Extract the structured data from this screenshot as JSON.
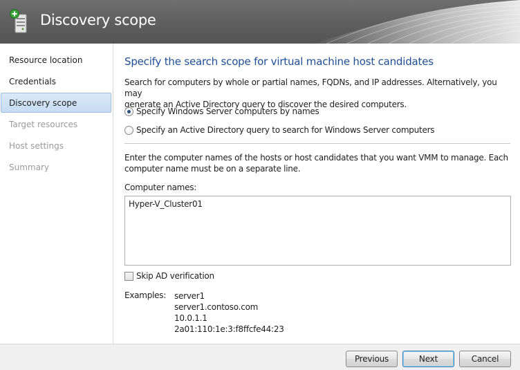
{
  "header": {
    "title": "Discovery scope",
    "icon": "server-add-icon"
  },
  "sidebar": {
    "items": [
      {
        "label": "Resource location",
        "state": "done"
      },
      {
        "label": "Credentials",
        "state": "done"
      },
      {
        "label": "Discovery scope",
        "state": "active"
      },
      {
        "label": "Target resources",
        "state": "pending"
      },
      {
        "label": "Host settings",
        "state": "pending"
      },
      {
        "label": "Summary",
        "state": "pending"
      }
    ]
  },
  "main": {
    "title": "Specify the search scope for virtual machine host candidates",
    "intro_line1": "Search for computers by whole or partial names, FQDNs, and IP addresses. Alternatively, you may",
    "intro_line2": "generate an Active Directory query to discover the desired computers.",
    "option_names": "Specify Windows Server computers by names",
    "option_ad_query": "Specify an Active Directory query to search for Windows Server computers",
    "selected_option": "option_names",
    "instructions_line1": "Enter the computer names of the hosts or host candidates that you want VMM to manage. Each",
    "instructions_line2": "computer name must be on a separate line.",
    "computer_names_label": "Computer names:",
    "computer_names_value": "Hyper-V_Cluster01",
    "skip_ad_label": "Skip AD verification",
    "skip_ad_checked": false,
    "examples_label": "Examples:",
    "examples": [
      "server1",
      "server1.contoso.com",
      "10.0.1.1",
      "2a01:110:1e:3:f8ffcfe44:23"
    ]
  },
  "footer": {
    "previous_label": "Previous",
    "next_label": "Next",
    "cancel_label": "Cancel"
  },
  "colors": {
    "header_bg": "#5e5e5e",
    "title_blue": "#1f4e96",
    "active_nav_bg": "#c7dcf3",
    "pending_text": "#9a9a9a"
  }
}
